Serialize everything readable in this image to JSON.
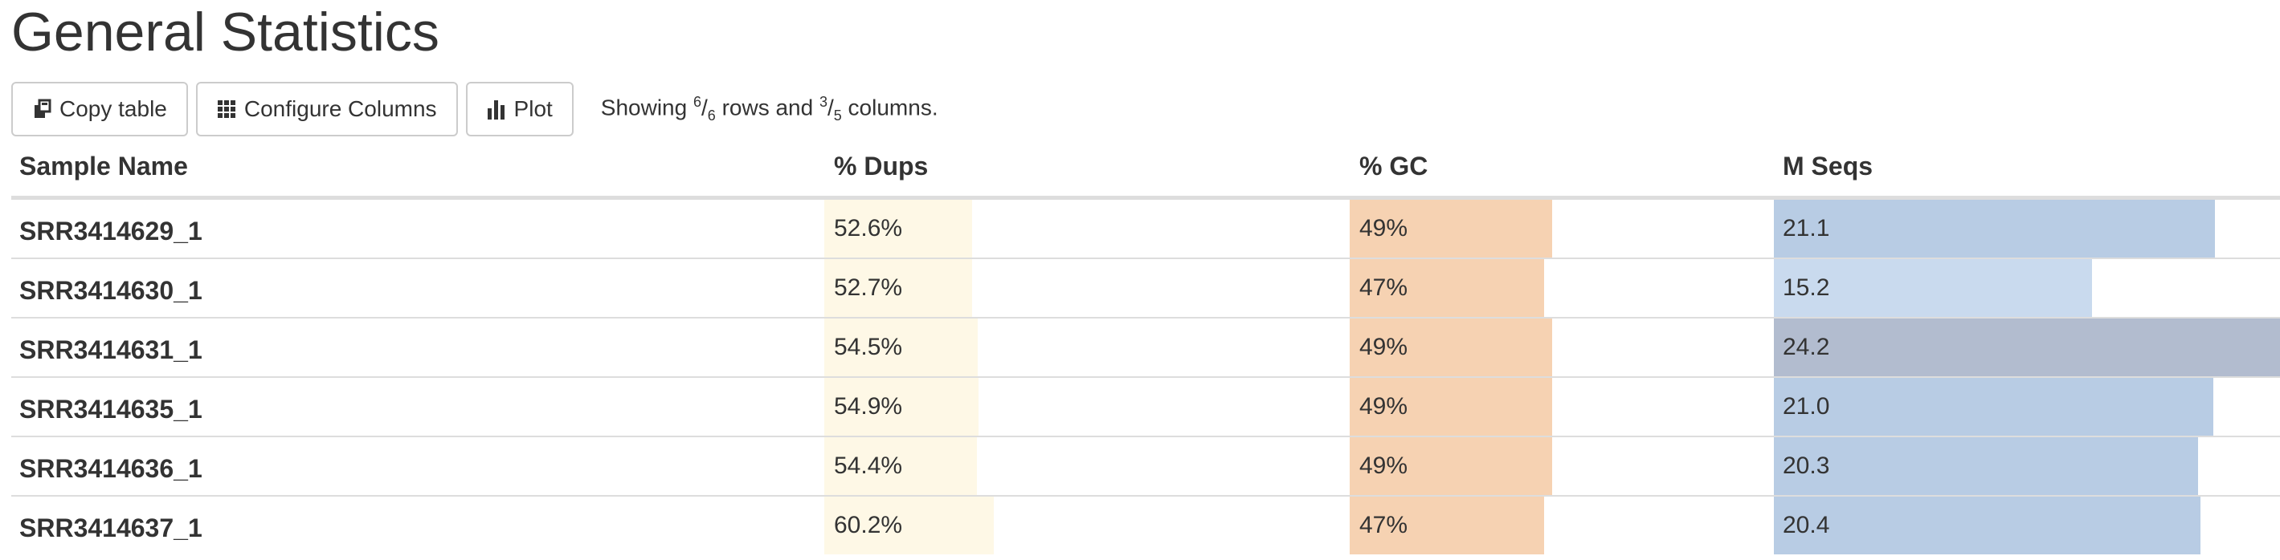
{
  "page": {
    "title": "General Statistics"
  },
  "toolbar": {
    "copy_label": "Copy table",
    "configure_label": "Configure Columns",
    "plot_label": "Plot",
    "showing": {
      "prefix": "Showing ",
      "rows_num": "6",
      "rows_den": "6",
      "middle": " rows and ",
      "cols_num": "3",
      "cols_den": "5",
      "suffix": " columns."
    }
  },
  "table": {
    "headers": [
      "Sample Name",
      "% Dups",
      "% GC",
      "M Seqs"
    ],
    "colors": {
      "dups": "#fef8e6",
      "gc": "#f6d2b2",
      "mseqs": "#b8cce4",
      "mseqs_light": "#c9daee",
      "mseqs_max": "#b2bccf"
    },
    "rows": [
      {
        "sample": "SRR3414629_1",
        "dups": "52.6%",
        "dups_v": 52.6,
        "gc": "49%",
        "gc_v": 49,
        "mseqs": "21.1",
        "mseqs_v": 21.1
      },
      {
        "sample": "SRR3414630_1",
        "dups": "52.7%",
        "dups_v": 52.7,
        "gc": "47%",
        "gc_v": 47,
        "mseqs": "15.2",
        "mseqs_v": 15.2
      },
      {
        "sample": "SRR3414631_1",
        "dups": "54.5%",
        "dups_v": 54.5,
        "gc": "49%",
        "gc_v": 49,
        "mseqs": "24.2",
        "mseqs_v": 24.2
      },
      {
        "sample": "SRR3414635_1",
        "dups": "54.9%",
        "dups_v": 54.9,
        "gc": "49%",
        "gc_v": 49,
        "mseqs": "21.0",
        "mseqs_v": 21.0
      },
      {
        "sample": "SRR3414636_1",
        "dups": "54.4%",
        "dups_v": 54.4,
        "gc": "49%",
        "gc_v": 49,
        "mseqs": "20.3",
        "mseqs_v": 20.3
      },
      {
        "sample": "SRR3414637_1",
        "dups": "60.2%",
        "dups_v": 60.2,
        "gc": "47%",
        "gc_v": 47,
        "mseqs": "20.4",
        "mseqs_v": 20.4
      }
    ]
  }
}
